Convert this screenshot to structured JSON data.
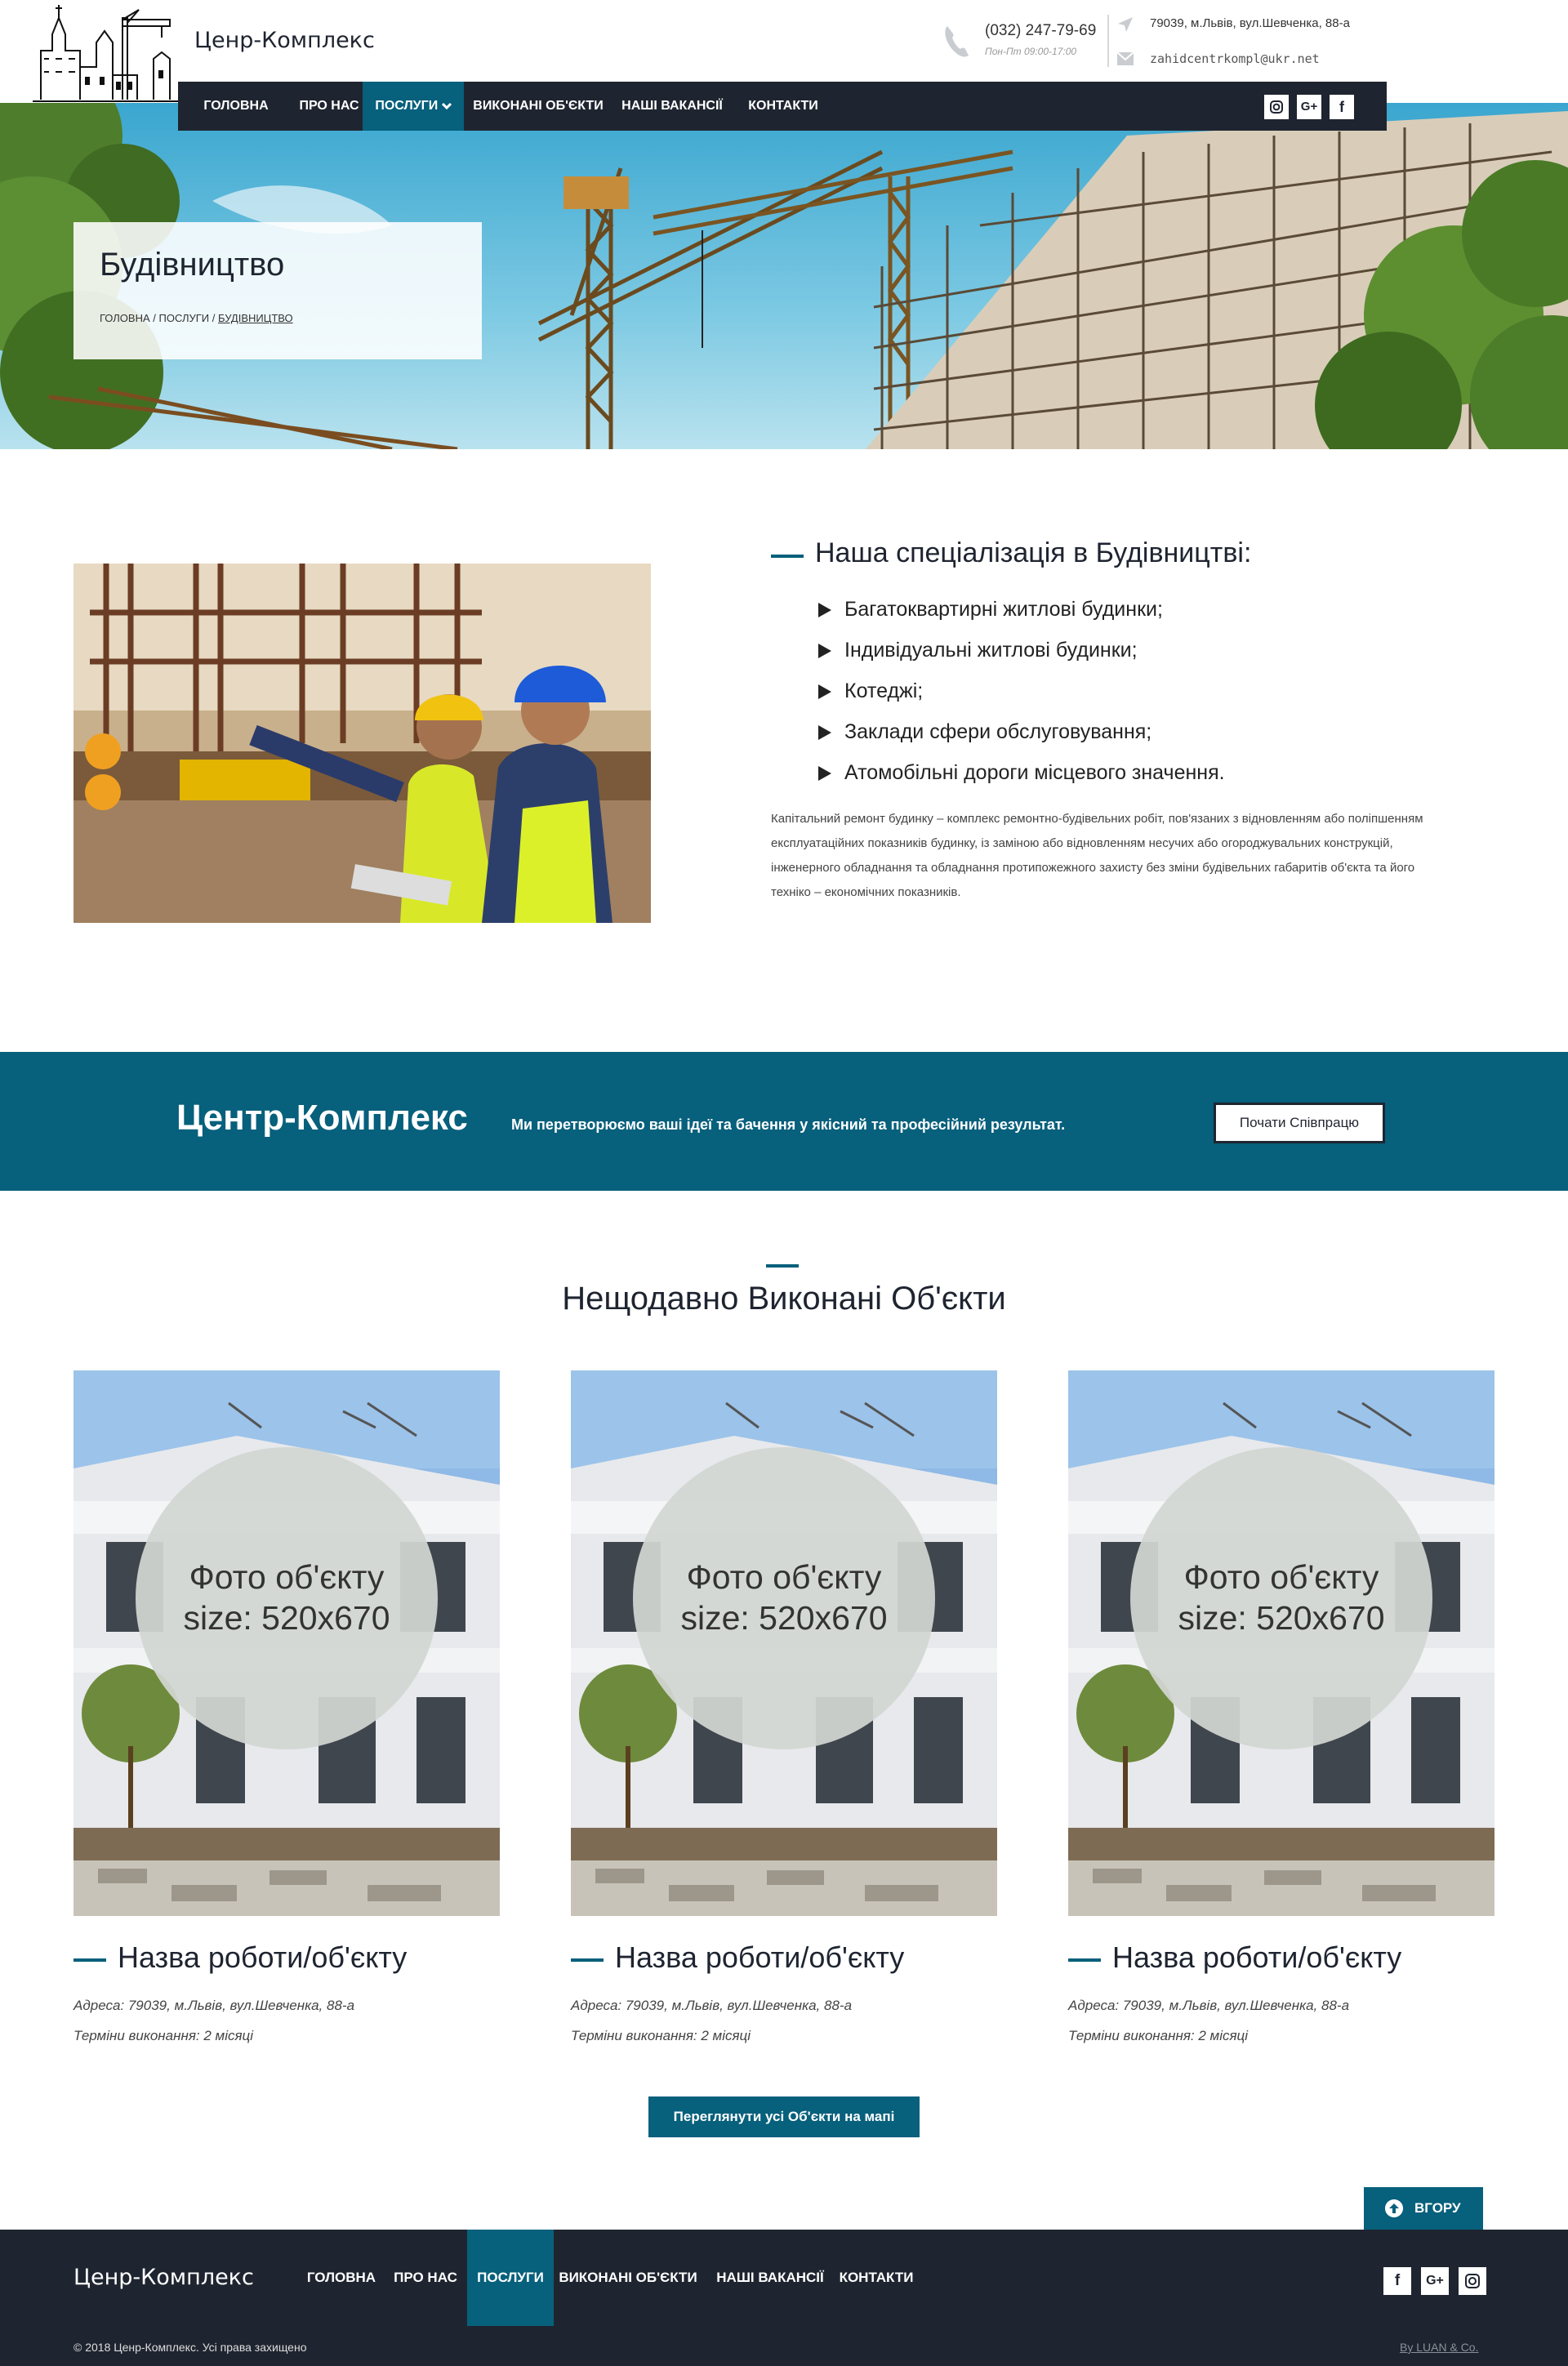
{
  "header": {
    "brand": "Ценр-Комплекс",
    "phone": "(032) 247-79-69",
    "hours": "Пон-Пт 09:00-17:00",
    "address": "79039, м.Львів, вул.Шевченка, 88-а",
    "email": "zahidcentrkompl@ukr.net"
  },
  "nav": {
    "items": [
      {
        "label": "ГОЛОВНА"
      },
      {
        "label": "ПРО НАС"
      },
      {
        "label": "ПОСЛУГИ"
      },
      {
        "label": "ВИКОНАНІ ОБ'ЄКТИ"
      },
      {
        "label": "НАШІ ВАКАНСІЇ"
      },
      {
        "label": "КОНТАКТИ"
      }
    ],
    "active_item": "ПОСЛУГИ",
    "social": [
      "instagram-icon",
      "google-plus-icon",
      "facebook-icon"
    ]
  },
  "hero": {
    "title": "Будівництво",
    "breadcrumb": [
      "ГОЛОВНА",
      "ПОСЛУГИ",
      "БУДІВНИЦТВО"
    ],
    "separator": "/"
  },
  "specialization": {
    "heading": "Наша спеціалізація в Будівництві:",
    "items": [
      "Багатоквартирні житлові будинки;",
      "Індивідуальні житлові будинки;",
      "Котеджі;",
      "Заклади сфери обслуговування;",
      "Атомобільні дороги місцевого значення."
    ],
    "description": "Капітальний ремонт будинку – комплекс ремонтно-будівельних робіт, пов'язаних з відновленням або поліпшенням експлуатаційних показників будинку, із заміною або відновленням несучих або огороджувальних конструкцій, інженерного обладнання та обладнання протипожежного захисту без зміни будівельних габаритів об'єкта та його техніко – економічних показників."
  },
  "cta": {
    "brand": "Центр-Комплекс",
    "text": "Ми перетворюємо ваші ідеї та бачення у якісний та професійний результат.",
    "button": "Почати Співпрацю"
  },
  "recent": {
    "title": "Нещодавно Виконані Об'єкти",
    "cards": [
      {
        "photo_line1": "Фото об'єкту",
        "photo_line2": "size: 520x670",
        "name": "Назва роботи/об'єкту",
        "address": "Адреса: 79039, м.Львів, вул.Шевченка, 88-а",
        "term": "Терміни виконання: 2 місяці"
      },
      {
        "photo_line1": "Фото об'єкту",
        "photo_line2": "size: 520x670",
        "name": "Назва роботи/об'єкту",
        "address": "Адреса: 79039, м.Львів, вул.Шевченка, 88-а",
        "term": "Терміни виконання: 2 місяці"
      },
      {
        "photo_line1": "Фото об'єкту",
        "photo_line2": "size: 520x670",
        "name": "Назва роботи/об'єкту",
        "address": "Адреса: 79039, м.Львів, вул.Шевченка, 88-а",
        "term": "Терміни виконання: 2 місяці"
      }
    ],
    "map_button": "Переглянути усі Об'єкти на мапі",
    "top_button": "ВГОРУ"
  },
  "footer": {
    "brand": "Ценр-Комплекс",
    "items": [
      {
        "label": "ГОЛОВНА"
      },
      {
        "label": "ПРО НАС"
      },
      {
        "label": "ПОСЛУГИ"
      },
      {
        "label": "ВИКОНАНІ ОБ'ЄКТИ"
      },
      {
        "label": "НАШІ ВАКАНСІЇ"
      },
      {
        "label": "КОНТАКТИ"
      }
    ],
    "active_item": "ПОСЛУГИ",
    "social": [
      "facebook-icon",
      "google-plus-icon",
      "instagram-icon"
    ],
    "copyright": "© 2018 Ценр-Комплекс. Усі права захищено",
    "credit": "By LUAN & Co."
  },
  "colors": {
    "accent": "#07607c",
    "dark": "#1f2530",
    "white": "#ffffff"
  }
}
